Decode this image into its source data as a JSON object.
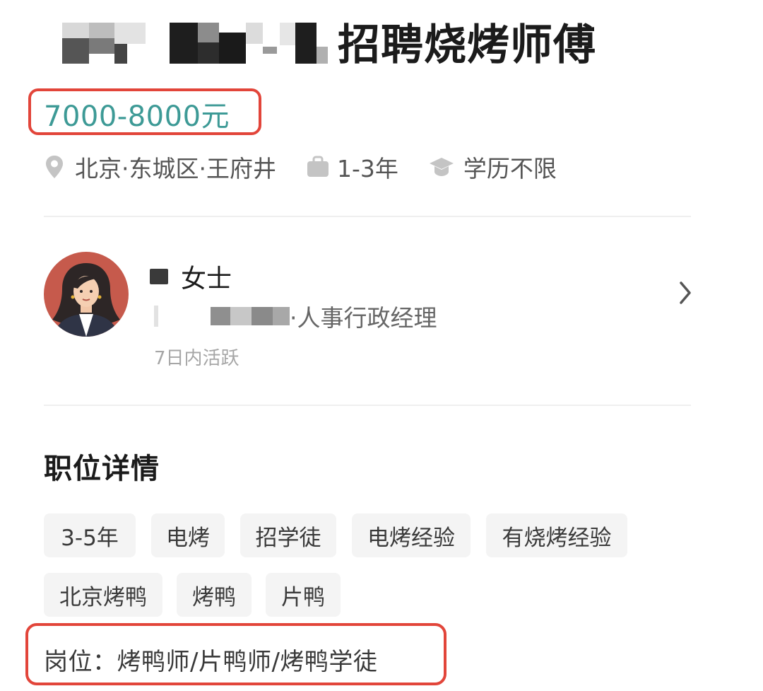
{
  "job": {
    "title": "招聘烧烤师傅",
    "salary": "7000-8000元",
    "location": "北京·东城区·王府井",
    "experience": "1-3年",
    "education": "学历不限"
  },
  "recruiter": {
    "name": "女士",
    "role": "·人事行政经理",
    "active": "7日内活跃"
  },
  "details": {
    "section_title": "职位详情",
    "tags": [
      "3-5年",
      "电烤",
      "招学徒",
      "电烤经验",
      "有烧烤经验",
      "北京烤鸭",
      "烤鸭",
      "片鸭"
    ],
    "position": "岗位：烤鸭师/片鸭师/烤鸭学徒"
  },
  "colors": {
    "salary": "#3d9a96",
    "highlight_border": "#e2453a",
    "tag_bg": "#f4f4f4"
  },
  "icons": [
    "location-pin-icon",
    "briefcase-icon",
    "graduation-cap-icon",
    "chevron-right-icon"
  ]
}
